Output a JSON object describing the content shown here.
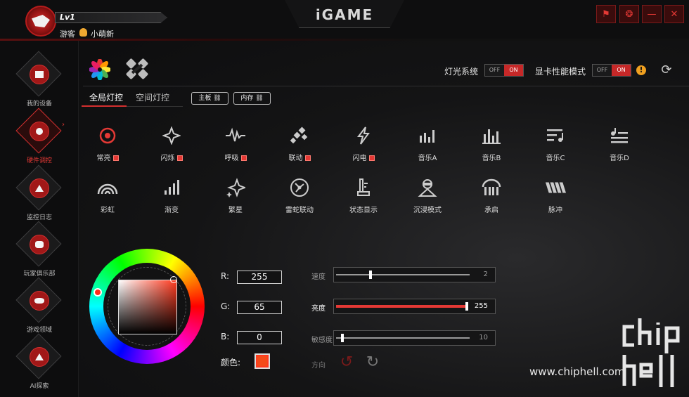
{
  "titlebar": {
    "level": "Lv1",
    "guest_label": "游客",
    "nickname": "小萌新",
    "logo": "iGAME",
    "buttons": [
      {
        "name": "feedback-icon",
        "glyph": "⚑"
      },
      {
        "name": "skin-icon",
        "glyph": "❂"
      },
      {
        "name": "minimize-icon",
        "glyph": "—"
      },
      {
        "name": "close-icon",
        "glyph": "✕"
      }
    ]
  },
  "sidebar": {
    "items": [
      {
        "label": "我的设备"
      },
      {
        "label": "硬件调控"
      },
      {
        "label": "监控日志"
      },
      {
        "label": "玩家俱乐部"
      },
      {
        "label": "游戏领域"
      },
      {
        "label": "AI探索"
      }
    ]
  },
  "toggles": {
    "light_system_label": "灯光系统",
    "perf_mode_label": "显卡性能模式",
    "off_text": "OFF",
    "on_text": "ON"
  },
  "tabs": {
    "global": "全局灯控",
    "spatial": "空间灯控",
    "chip_board": "主板",
    "chip_memory": "内存"
  },
  "effects": {
    "row1": [
      "常亮",
      "闪烁",
      "呼吸",
      "联动",
      "闪电",
      "音乐A",
      "音乐B",
      "音乐C",
      "音乐D"
    ],
    "row2": [
      "彩虹",
      "渐变",
      "繁星",
      "雷蛇联动",
      "状态显示",
      "沉浸模式",
      "承启",
      "脉冲"
    ]
  },
  "color": {
    "r_label": "R:",
    "g_label": "G:",
    "b_label": "B:",
    "r": "255",
    "g": "65",
    "b": "0",
    "color_label": "颜色:",
    "swatch": "#ff4100"
  },
  "sliders": {
    "speed_label": "速度",
    "speed_value": "2",
    "brightness_label": "亮度",
    "brightness_value": "255",
    "sensitivity_label": "敏感度",
    "sensitivity_value": "10",
    "direction_label": "方向"
  },
  "watermark": {
    "url": "www.chiphell.com"
  }
}
